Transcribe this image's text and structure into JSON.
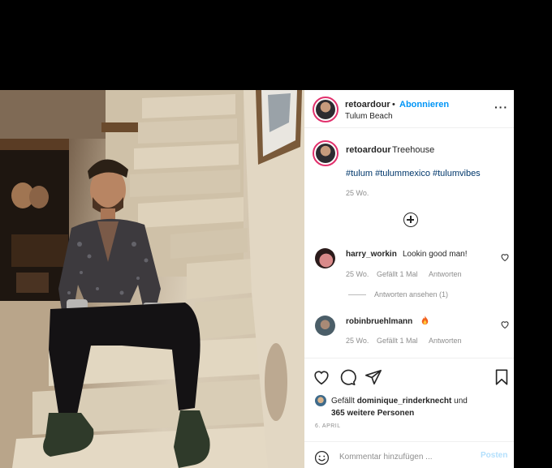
{
  "header": {
    "username": "retoardour",
    "separator": "•",
    "follow_label": "Abonnieren",
    "location": "Tulum Beach",
    "more_label": "···"
  },
  "caption": {
    "username": "retoardour",
    "text": "Treehouse",
    "hashtags": "#tulum #tulummexico #tulumvibes",
    "age": "25 Wo."
  },
  "comments": [
    {
      "username": "harry_workin",
      "text": "Lookin good man!",
      "age": "25 Wo.",
      "likes": "Gefällt 1 Mal",
      "reply_label": "Antworten",
      "view_replies": "Antworten ansehen (1)"
    },
    {
      "username": "robinbruehlmann",
      "text": "",
      "age": "25 Wo.",
      "likes": "Gefällt 1 Mal",
      "reply_label": "Antworten"
    }
  ],
  "likes": {
    "prefix": "Gefällt",
    "user": "dominique_rinderknecht",
    "conjunction": "und",
    "others": "365 weitere Personen"
  },
  "date": "6. APRIL",
  "comment_box": {
    "placeholder": "Kommentar hinzufügen ...",
    "post_label": "Posten"
  },
  "colors": {
    "accent": "#0095f6",
    "story_ring": "#e1306c",
    "hashtag": "#00376b",
    "muted": "#8e8e8e"
  },
  "icons": [
    "heart-icon",
    "comment-icon",
    "share-icon",
    "bookmark-icon",
    "emoji-icon",
    "plus-circle-icon",
    "fire-emoji"
  ]
}
